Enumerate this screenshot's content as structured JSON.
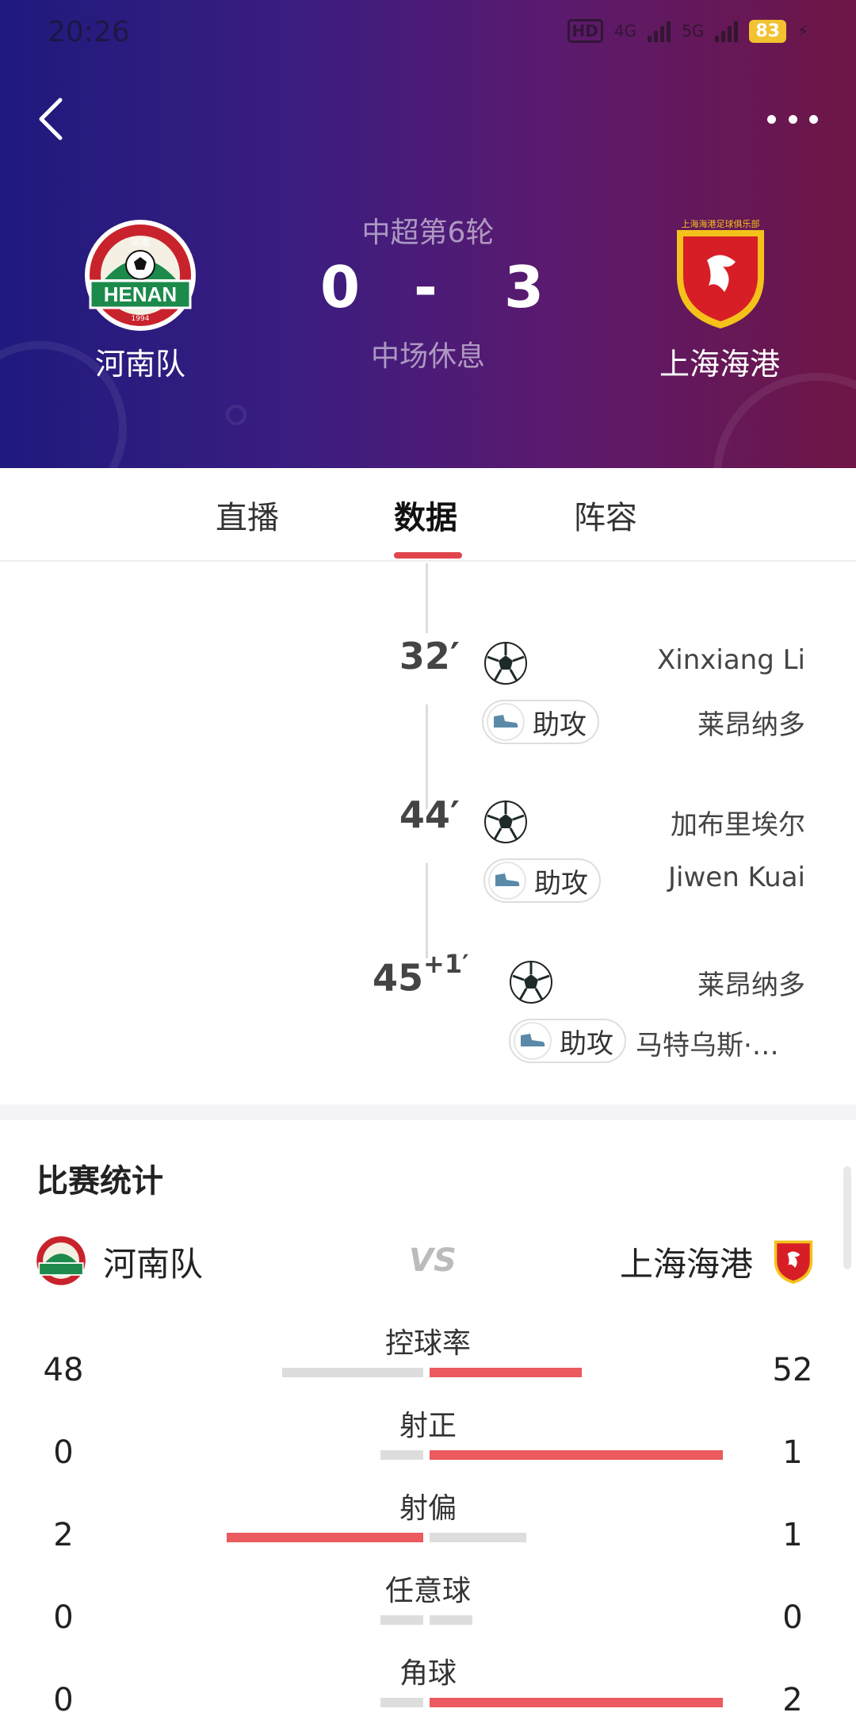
{
  "status_bar": {
    "time": "20:26",
    "network": "HD",
    "signal1": "4G",
    "signal2": "5G",
    "battery": "83"
  },
  "header": {
    "back_icon": "chevron-left-icon",
    "more_icon": "more-dots-icon",
    "round": "中超第6轮",
    "home": {
      "name": "河南队",
      "score": "0",
      "logo_text": "HENAN",
      "logo_arc": "HENAN FOOTBALL CLUB",
      "logo_cn": "河南",
      "logo_year": "1994"
    },
    "away": {
      "name": "上海海港",
      "score": "3",
      "logo_arc": "上海海港足球俱乐部"
    },
    "score_dash": "-",
    "state": "中场休息"
  },
  "tabs": [
    {
      "label": "直播",
      "active": false
    },
    {
      "label": "数据",
      "active": true
    },
    {
      "label": "阵容",
      "active": false
    }
  ],
  "events": [
    {
      "minute": "32′",
      "extra": "",
      "scorer": "Xinxiang Li",
      "assist_label": "助攻",
      "assist": "莱昂纳多"
    },
    {
      "minute": "44′",
      "extra": "",
      "scorer": "加布里埃尔",
      "assist_label": "助攻",
      "assist": "Jiwen Kuai"
    },
    {
      "minute": "45",
      "extra": "+1′",
      "scorer": "莱昂纳多",
      "assist_label": "助攻",
      "assist": "马特乌斯·…"
    }
  ],
  "stats": {
    "title": "比赛统计",
    "home_name": "河南队",
    "away_name": "上海海港",
    "vs": "VS",
    "rows": [
      {
        "label": "控球率",
        "home": "48",
        "away": "52",
        "home_frac": 0.48,
        "away_frac": 0.52,
        "leader": "away"
      },
      {
        "label": "射正",
        "home": "0",
        "away": "1",
        "home_frac": 0,
        "away_frac": 1,
        "leader": "away"
      },
      {
        "label": "射偏",
        "home": "2",
        "away": "1",
        "home_frac": 0.67,
        "away_frac": 0.33,
        "leader": "home"
      },
      {
        "label": "任意球",
        "home": "0",
        "away": "0",
        "home_frac": 0,
        "away_frac": 0,
        "leader": "none"
      },
      {
        "label": "角球",
        "home": "0",
        "away": "2",
        "home_frac": 0,
        "away_frac": 1,
        "leader": "away"
      }
    ]
  },
  "colors": {
    "accent": "#e0454e",
    "bar_red": "#ea5a5e",
    "bar_grey": "#dddddd"
  }
}
